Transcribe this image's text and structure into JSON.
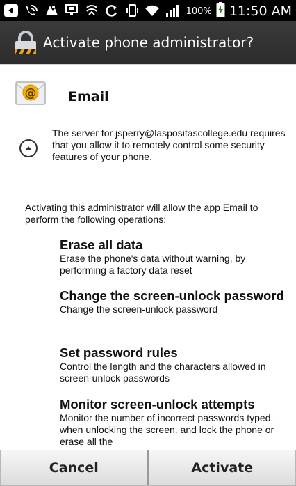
{
  "status_bar": {
    "icons": [
      "back-arrow-icon",
      "wifi-calling-icon",
      "person-icon",
      "screen-mirroring-icon",
      "nfc-icon",
      "sync-icon",
      "vibrate-icon",
      "wifi-icon",
      "signal-icon"
    ],
    "battery_percent": "100%",
    "time": "11:50 AM"
  },
  "title_bar": {
    "title": "Activate phone administrator?",
    "icon": "padlock-icon"
  },
  "app": {
    "name": "Email",
    "icon": "email-at-icon"
  },
  "message": {
    "server_text": "The server for jsperry@laspositascollege.edu requires that you allow it to remotely control some security features of your phone.",
    "activating_text": "Activating this administrator will allow the app Email to perform the following operations:"
  },
  "policies": [
    {
      "title": "Erase all data",
      "description": "Erase the phone's data without warning, by performing a factory data reset"
    },
    {
      "title": "Change the screen-unlock password",
      "description": "Change the screen-unlock password"
    },
    {
      "title": "Set password rules",
      "description": "Control the length and the characters allowed in screen-unlock passwords"
    },
    {
      "title": "Monitor screen-unlock attempts",
      "description": "Monitor the number of incorrect passwords typed. when unlocking the screen. and lock the phone or erase all the"
    }
  ],
  "buttons": {
    "cancel": "Cancel",
    "activate": "Activate"
  },
  "colors": {
    "status_bar_bg": "#000000",
    "title_bar_bg": "#333333",
    "content_bg": "#ffffff",
    "button_bg": "#e6e6e6"
  }
}
